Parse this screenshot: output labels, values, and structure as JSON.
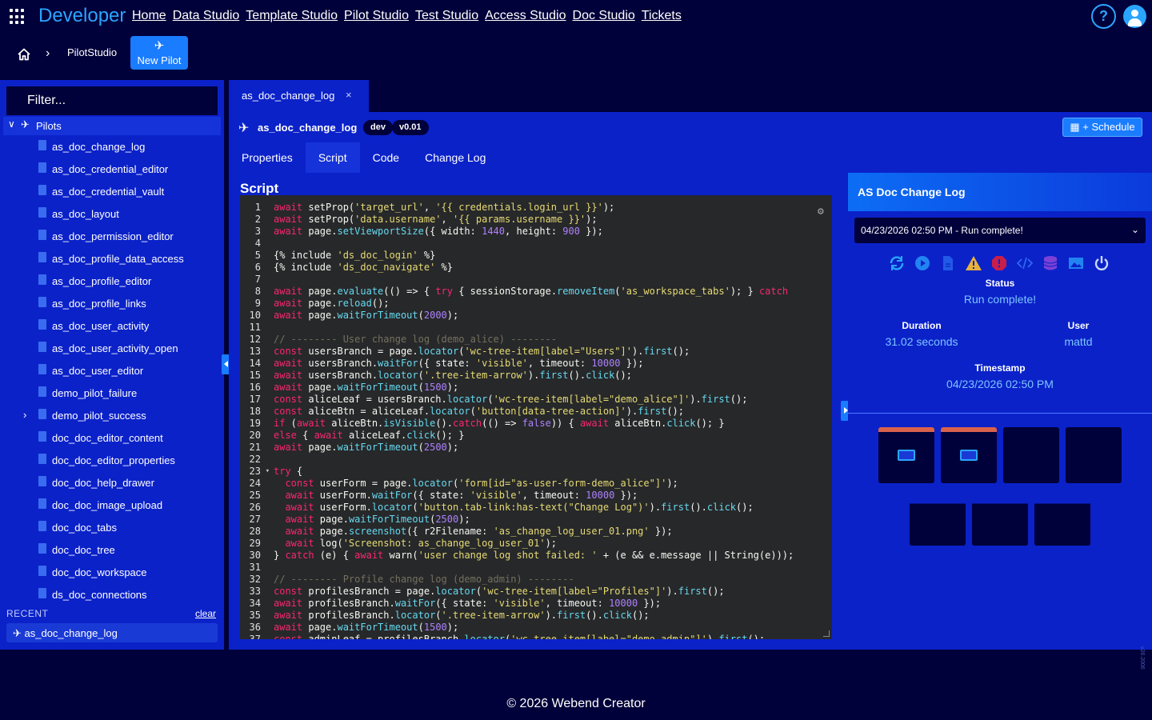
{
  "app": {
    "brand": "Developer",
    "nav": [
      "Home",
      "Data Studio",
      "Template Studio",
      "Pilot Studio",
      "Test Studio",
      "Access Studio",
      "Doc Studio",
      "Tickets"
    ],
    "help_label": "?"
  },
  "breadcrumb": {
    "current": "PilotStudio",
    "new_pilot_label": "New Pilot"
  },
  "sidebar": {
    "filter_placeholder": "Filter...",
    "root_label": "Pilots",
    "items": [
      "as_doc_change_log",
      "as_doc_credential_editor",
      "as_doc_credential_vault",
      "as_doc_layout",
      "as_doc_permission_editor",
      "as_doc_profile_data_access",
      "as_doc_profile_editor",
      "as_doc_profile_links",
      "as_doc_user_activity",
      "as_doc_user_activity_open",
      "as_doc_user_editor",
      "demo_pilot_failure",
      "demo_pilot_success",
      "doc_doc_editor_content",
      "doc_doc_editor_properties",
      "doc_doc_help_drawer",
      "doc_doc_image_upload",
      "doc_doc_tabs",
      "doc_doc_tree",
      "doc_doc_workspace",
      "ds_doc_connections"
    ],
    "recent_header": "RECENT",
    "recent_clear": "clear",
    "recent_item": "as_doc_change_log"
  },
  "editor_tab": {
    "label": "as_doc_change_log",
    "close": "×"
  },
  "pilot": {
    "name": "as_doc_change_log",
    "env": "dev",
    "version": "v0.01",
    "schedule_label": "+ Schedule",
    "tabs": [
      "Properties",
      "Script",
      "Code",
      "Change Log"
    ],
    "active_tab": "Script",
    "section_title": "Script"
  },
  "script": {
    "line_count": 37,
    "lines": [
      "await setProp('target_url', '{{ credentials.login_url }}');",
      "await setProp('data.username', '{{ params.username }}');",
      "await page.setViewportSize({ width: 1440, height: 900 });",
      "",
      "{% include 'ds_doc_login' %}",
      "{% include 'ds_doc_navigate' %}",
      "",
      "await page.evaluate(() => { try { sessionStorage.removeItem('as_workspace_tabs'); } catch",
      "await page.reload();",
      "await page.waitForTimeout(2000);",
      "",
      "// -------- User change log (demo_alice) --------",
      "const usersBranch = page.locator('wc-tree-item[label=\"Users\"]').first();",
      "await usersBranch.waitFor({ state: 'visible', timeout: 10000 });",
      "await usersBranch.locator('.tree-item-arrow').first().click();",
      "await page.waitForTimeout(1500);",
      "const aliceLeaf = usersBranch.locator('wc-tree-item[label=\"demo_alice\"]').first();",
      "const aliceBtn = aliceLeaf.locator('button[data-tree-action]').first();",
      "if (await aliceBtn.isVisible().catch(() => false)) { await aliceBtn.click(); }",
      "else { await aliceLeaf.click(); }",
      "await page.waitForTimeout(2500);",
      "",
      "try {",
      "  const userForm = page.locator('form[id=\"as-user-form-demo_alice\"]');",
      "  await userForm.waitFor({ state: 'visible', timeout: 10000 });",
      "  await userForm.locator('button.tab-link:has-text(\"Change Log\")').first().click();",
      "  await page.waitForTimeout(2500);",
      "  await page.screenshot({ r2Filename: 'as_change_log_user_01.png' });",
      "  await log('Screenshot: as_change_log_user_01');",
      "} catch (e) { await warn('user change log shot failed: ' + (e && e.message || String(e)));",
      "",
      "// -------- Profile change log (demo_admin) --------",
      "const profilesBranch = page.locator('wc-tree-item[label=\"Profiles\"]').first();",
      "await profilesBranch.waitFor({ state: 'visible', timeout: 10000 });",
      "await profilesBranch.locator('.tree-item-arrow').first().click();",
      "await page.waitForTimeout(1500);",
      "const adminLeaf = profilesBranch.locator('wc-tree-item[label=\"demo_admin\"]').first();"
    ]
  },
  "run_panel": {
    "title": "AS Doc Change Log",
    "selected_run": "04/23/2026 02:50 PM - Run complete!",
    "status_label": "Status",
    "status_value": "Run complete!",
    "duration_label": "Duration",
    "duration_value": "31.02 seconds",
    "user_label": "User",
    "user_value": "mattd",
    "timestamp_label": "Timestamp",
    "timestamp_value": "04/23/2026 02:50 PM",
    "tool_icons": [
      "refresh-icon",
      "play-icon",
      "document-icon",
      "warning-icon",
      "error-icon",
      "code-icon",
      "database-icon",
      "image-icon",
      "power-icon"
    ]
  },
  "footer": {
    "copyright": "© 2026 Webend Creator",
    "version": "v26.2006"
  },
  "colors": {
    "accent": "#1a7cff",
    "panel": "#0b22c9",
    "background": "#00003a",
    "link": "#7cc4ff"
  }
}
